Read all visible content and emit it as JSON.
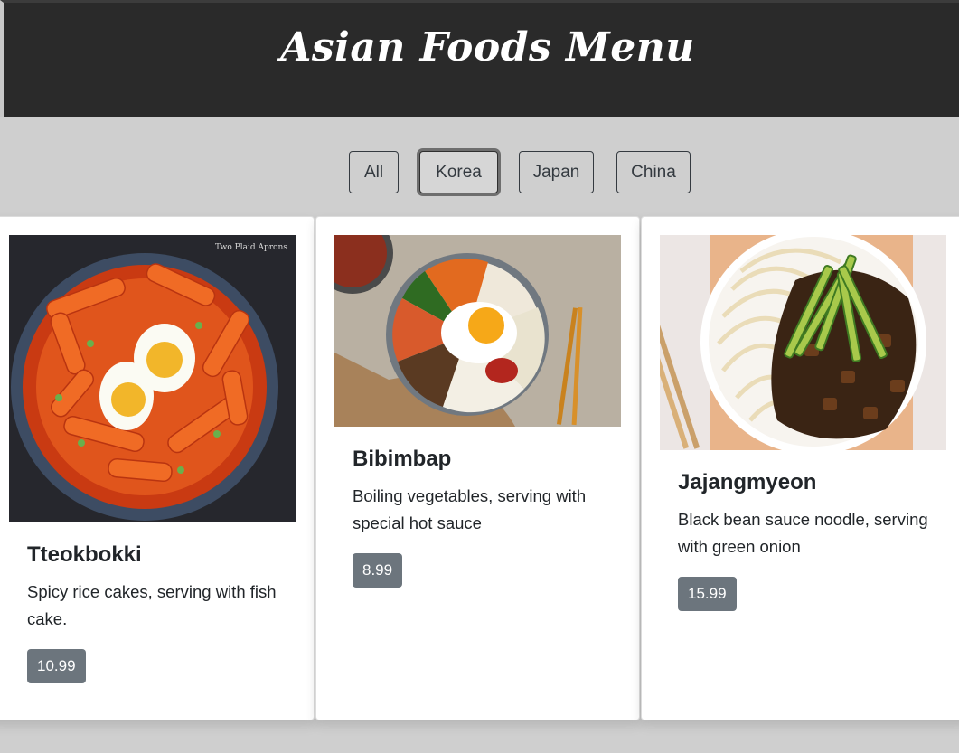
{
  "header": {
    "title": "Asian Foods Menu"
  },
  "filters": [
    {
      "label": "All",
      "active": false
    },
    {
      "label": "Korea",
      "active": true
    },
    {
      "label": "Japan",
      "active": false
    },
    {
      "label": "China",
      "active": false
    }
  ],
  "cards": [
    {
      "title": "Tteokbokki",
      "description": "Spicy rice cakes, serving with fish cake.",
      "price": "10.99",
      "image_watermark": "Two Plaid Aprons"
    },
    {
      "title": "Bibimbap",
      "description": "Boiling vegetables, serving with special hot sauce",
      "price": "8.99"
    },
    {
      "title": "Jajangmyeon",
      "description": "Black bean sauce noodle, serving with green onion",
      "price": "15.99"
    }
  ]
}
